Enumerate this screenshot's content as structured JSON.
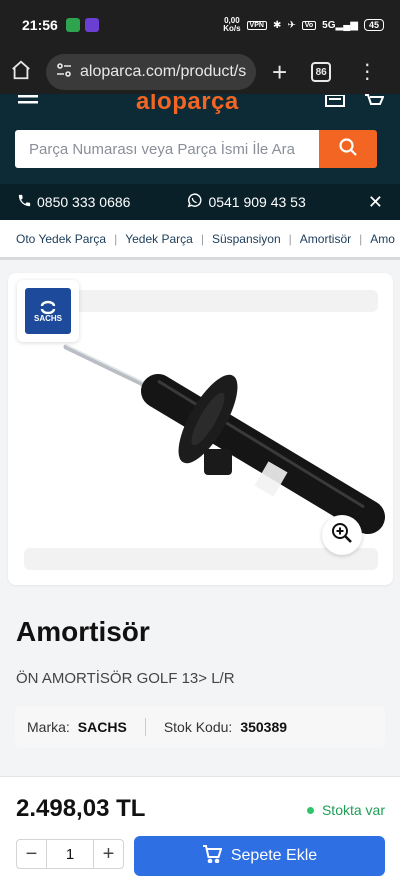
{
  "status_bar": {
    "time": "21:56",
    "net_speed_value": "0,00",
    "net_speed_unit": "Ko/s",
    "vpn_label": "VPN",
    "signal_label": "5G",
    "battery": "45"
  },
  "browser": {
    "url": "aloparca.com/product/s",
    "tab_count": "86"
  },
  "header": {
    "logo_part1": "alo",
    "logo_part2": "parça",
    "search_placeholder": "Parça Numarası veya Parça İsmi İle Ara"
  },
  "contact": {
    "phone": "0850 333 0686",
    "whatsapp": "0541 909 43 53"
  },
  "breadcrumb": [
    "Oto Yedek Parça",
    "Yedek Parça",
    "Süspansiyon",
    "Amortisör",
    "Amo"
  ],
  "product": {
    "brand_badge": "SACHS",
    "title": "Amortisör",
    "description": "ÖN AMORTİSÖR GOLF 13> L/R",
    "brand_label": "Marka:",
    "brand_value": "SACHS",
    "code_label": "Stok Kodu:",
    "code_value": "350389",
    "price": "2.498,03 TL",
    "stock_status": "Stokta var",
    "quantity": "1",
    "add_to_cart": "Sepete Ekle"
  },
  "colors": {
    "header_bg": "#0d2b36",
    "brand_orange": "#f26522",
    "cart_blue": "#2f6fe4",
    "stock_green": "#2ec56c"
  }
}
